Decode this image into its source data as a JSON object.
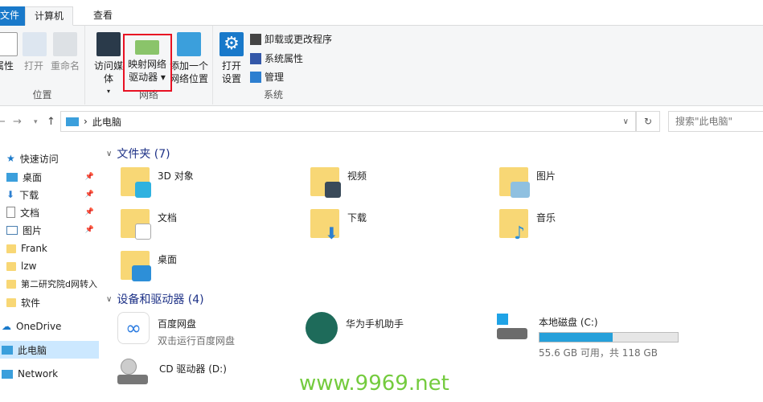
{
  "tabs": {
    "file": "文件",
    "computer": "计算机",
    "view": "查看"
  },
  "ribbon": {
    "location": {
      "label": "位置",
      "properties": "属性",
      "open": "打开",
      "rename": "重命名"
    },
    "network": {
      "label": "网络",
      "media": "访问媒体",
      "map1": "映射网络",
      "map2": "驱动器",
      "add1": "添加一个",
      "add2": "网络位置"
    },
    "system": {
      "label": "系统",
      "settings1": "打开",
      "settings2": "设置",
      "uninstall": "卸载或更改程序",
      "props": "系统属性",
      "manage": "管理"
    }
  },
  "address": {
    "path": "此电脑",
    "search_placeholder": "搜索\"此电脑\""
  },
  "sidebar": {
    "items": [
      {
        "label": "快速访问"
      },
      {
        "label": "桌面"
      },
      {
        "label": "下载"
      },
      {
        "label": "文档"
      },
      {
        "label": "图片"
      },
      {
        "label": "Frank"
      },
      {
        "label": "lzw"
      },
      {
        "label": "第二研究院d网转入"
      },
      {
        "label": "软件"
      },
      {
        "label": "OneDrive"
      },
      {
        "label": "此电脑"
      },
      {
        "label": "Network"
      }
    ]
  },
  "folders": {
    "header": "文件夹 (7)",
    "items": [
      {
        "name": "3D 对象"
      },
      {
        "name": "视频"
      },
      {
        "name": "图片"
      },
      {
        "name": "文档"
      },
      {
        "name": "下载"
      },
      {
        "name": "音乐"
      },
      {
        "name": "桌面"
      }
    ]
  },
  "devices": {
    "header": "设备和驱动器 (4)",
    "items": [
      {
        "name": "百度网盘",
        "sub": "双击运行百度网盘"
      },
      {
        "name": "华为手机助手"
      },
      {
        "name": "本地磁盘 (C:)",
        "sub": "55.6 GB 可用，共 118 GB",
        "used_percent": 53
      },
      {
        "name": "CD 驱动器 (D:)"
      }
    ]
  },
  "watermark": "www.9969.net",
  "colors": {
    "accent": "#1979ca",
    "bar": "#26a0da",
    "highlight": "#e81123"
  }
}
